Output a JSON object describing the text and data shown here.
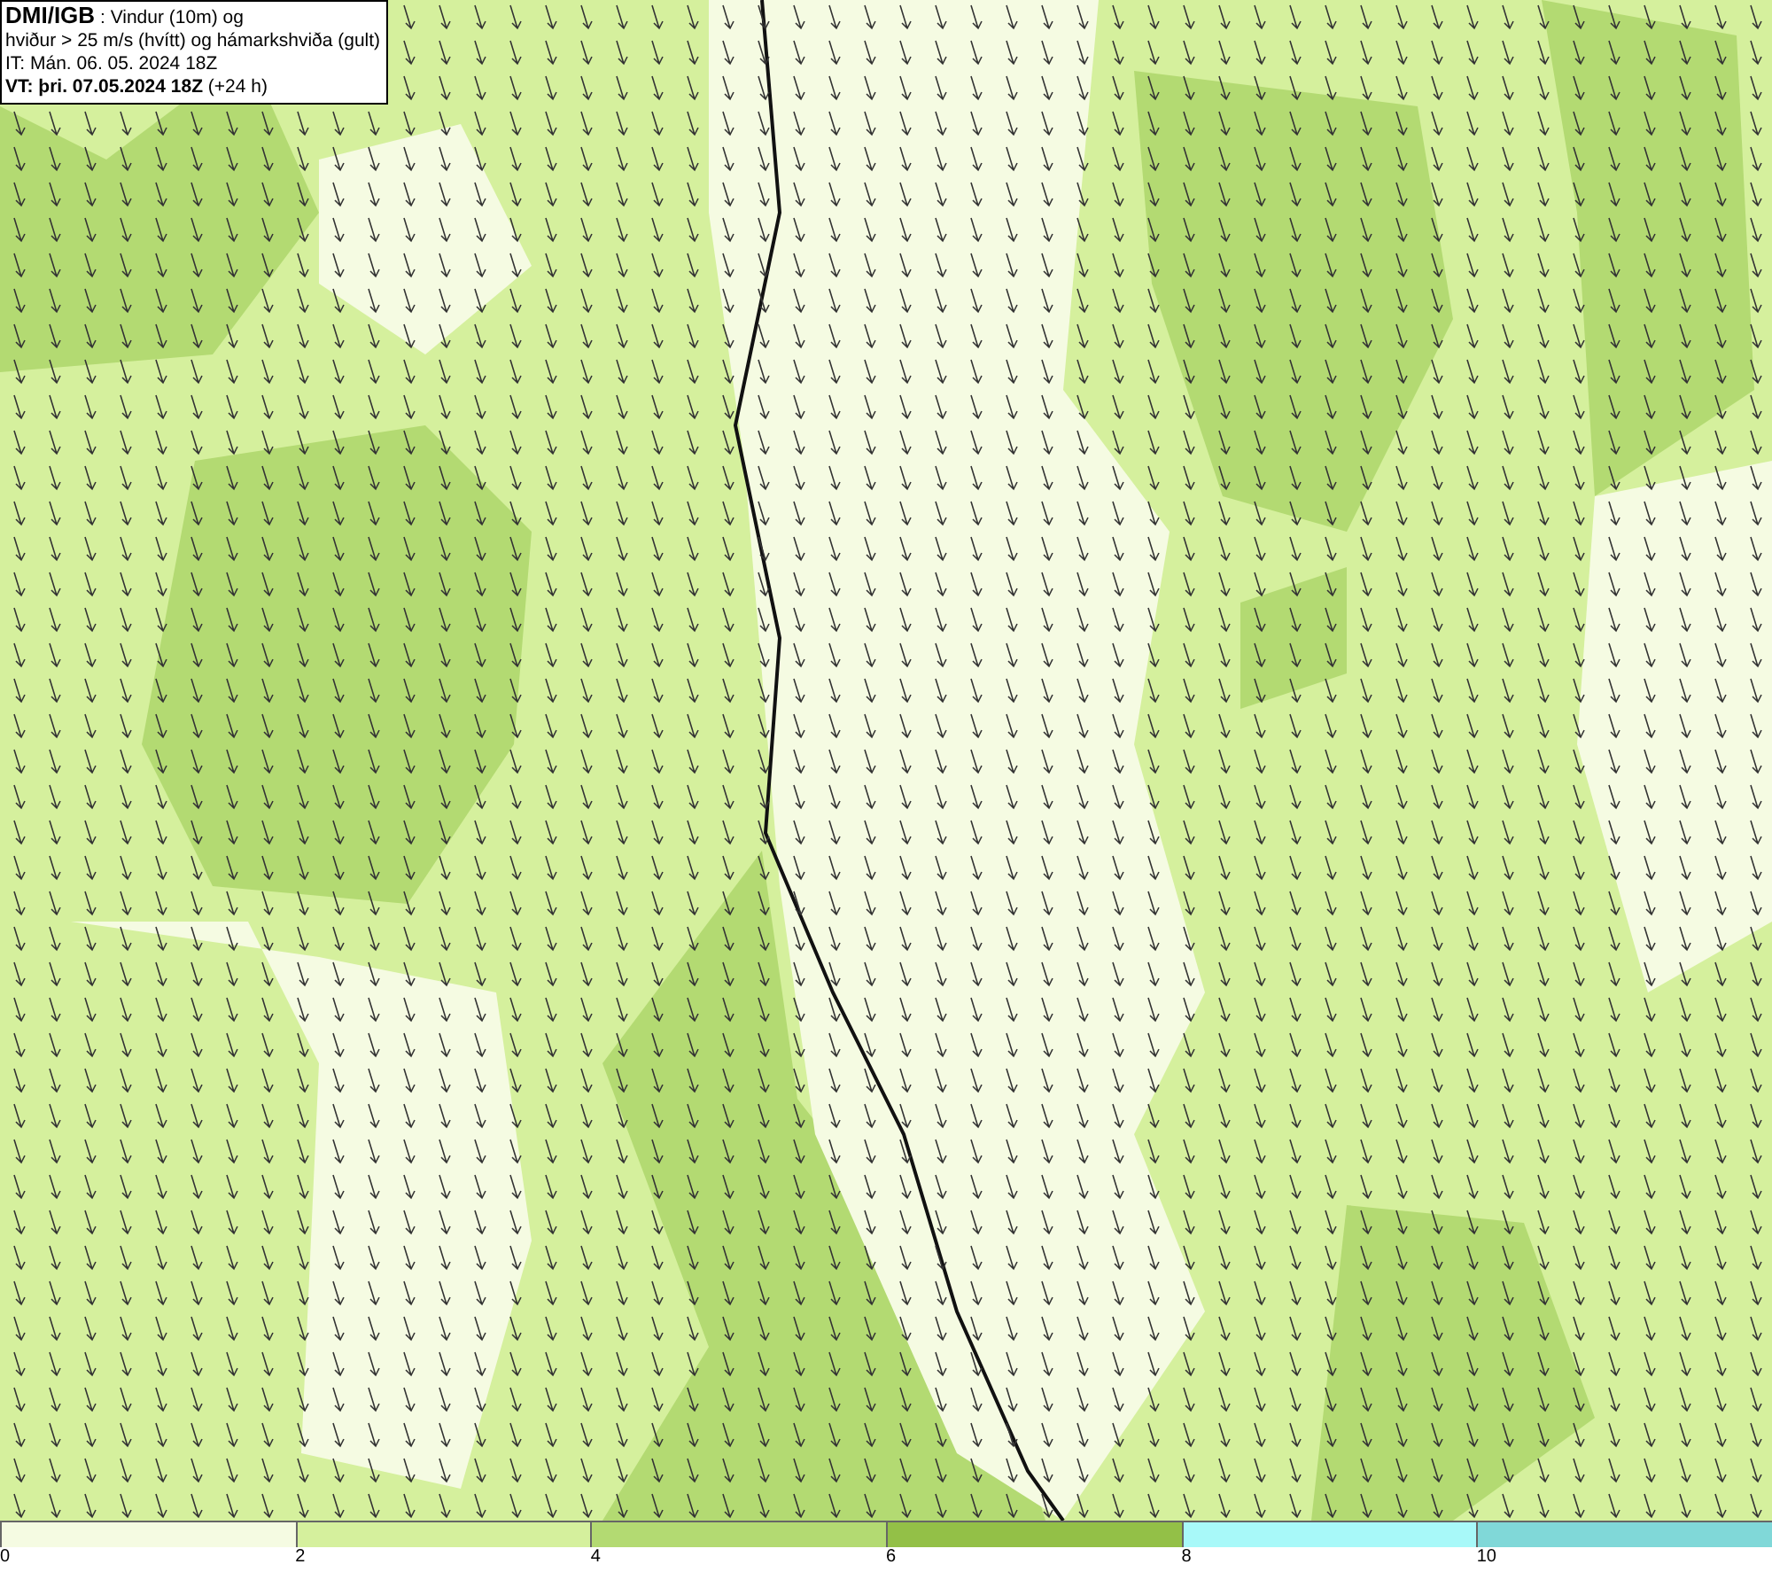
{
  "info_box": {
    "lines": [
      "**DMI/IGB** : Vindur (10m) og",
      "hviður > 25 m/s (hvítt) og hámarkshviða (gult)",
      "IT: Mán. 06. 05. 2024 18Z",
      "**VT: þri. 07.05.2024 18Z** (+24 h)"
    ]
  },
  "legend": {
    "bins": [
      {
        "label": "0",
        "color": "#f5fbe2"
      },
      {
        "label": "2",
        "color": "#d5f09d"
      },
      {
        "label": "4",
        "color": "#b3da72"
      },
      {
        "label": "6",
        "color": "#93c047"
      },
      {
        "label": "8",
        "color": "#a8f9f9"
      },
      {
        "label": "10",
        "color": "#80d8d8"
      }
    ]
  }
}
